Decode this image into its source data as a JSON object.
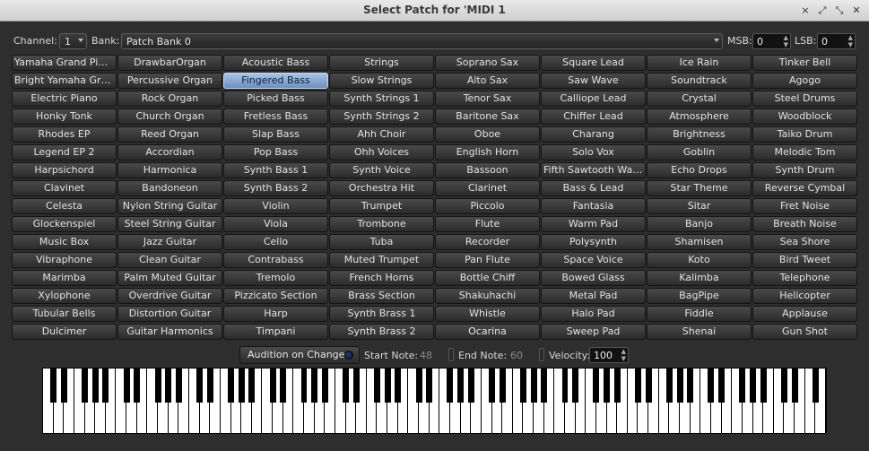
{
  "window": {
    "title": "Select Patch for 'MIDI 1",
    "buttons": [
      "×",
      "⤢",
      "⤡",
      "✕"
    ]
  },
  "toolbar": {
    "channel_label": "Channel:",
    "channel_value": "1",
    "bank_label": "Bank:",
    "bank_value": "Patch Bank 0",
    "msb_label": "MSB:",
    "msb_value": "0",
    "lsb_label": "LSB:",
    "lsb_value": "0"
  },
  "patches": [
    "Yamaha Grand Piano",
    "Bright Yamaha Grand",
    "Electric Piano",
    "Honky Tonk",
    "Rhodes EP",
    "Legend EP 2",
    "Harpsichord",
    "Clavinet",
    "Celesta",
    "Glockenspiel",
    "Music Box",
    "Vibraphone",
    "Marimba",
    "Xylophone",
    "Tubular Bells",
    "Dulcimer",
    "DrawbarOrgan",
    "Percussive Organ",
    "Rock Organ",
    "Church Organ",
    "Reed Organ",
    "Accordian",
    "Harmonica",
    "Bandoneon",
    "Nylon String Guitar",
    "Steel String Guitar",
    "Jazz Guitar",
    "Clean Guitar",
    "Palm Muted Guitar",
    "Overdrive Guitar",
    "Distortion Guitar",
    "Guitar Harmonics",
    "Acoustic Bass",
    "Fingered Bass",
    "Picked Bass",
    "Fretless Bass",
    "Slap Bass",
    "Pop Bass",
    "Synth Bass 1",
    "Synth Bass 2",
    "Violin",
    "Viola",
    "Cello",
    "Contrabass",
    "Tremolo",
    "Pizzicato Section",
    "Harp",
    "Timpani",
    "Strings",
    "Slow Strings",
    "Synth Strings 1",
    "Synth Strings 2",
    "Ahh Choir",
    "Ohh Voices",
    "Synth Voice",
    "Orchestra Hit",
    "Trumpet",
    "Trombone",
    "Tuba",
    "Muted Trumpet",
    "French Horns",
    "Brass Section",
    "Synth Brass 1",
    "Synth Brass 2",
    "Soprano Sax",
    "Alto Sax",
    "Tenor Sax",
    "Baritone Sax",
    "Oboe",
    "English Horn",
    "Bassoon",
    "Clarinet",
    "Piccolo",
    "Flute",
    "Recorder",
    "Pan Flute",
    "Bottle Chiff",
    "Shakuhachi",
    "Whistle",
    "Ocarina",
    "Square Lead",
    "Saw Wave",
    "Calliope Lead",
    "Chiffer Lead",
    "Charang",
    "Solo Vox",
    "Fifth Sawtooth Wave",
    "Bass & Lead",
    "Fantasia",
    "Warm Pad",
    "Polysynth",
    "Space Voice",
    "Bowed Glass",
    "Metal Pad",
    "Halo Pad",
    "Sweep Pad",
    "Ice Rain",
    "Soundtrack",
    "Crystal",
    "Atmosphere",
    "Brightness",
    "Goblin",
    "Echo Drops",
    "Star Theme",
    "Sitar",
    "Banjo",
    "Shamisen",
    "Koto",
    "Kalimba",
    "BagPipe",
    "Fiddle",
    "Shenai",
    "Tinker Bell",
    "Agogo",
    "Steel Drums",
    "Woodblock",
    "Taiko Drum",
    "Melodic Tom",
    "Synth Drum",
    "Reverse Cymbal",
    "Fret Noise",
    "Breath Noise",
    "Sea Shore",
    "Bird Tweet",
    "Telephone",
    "Helicopter",
    "Applause",
    "Gun Shot"
  ],
  "selected_patch": "Fingered Bass",
  "controls": {
    "audition_label": "Audition on Change",
    "start_note_label": "Start Note:",
    "start_note_value": "48",
    "end_note_label": "End Note:",
    "end_note_value": "60",
    "velocity_label": "Velocity:",
    "velocity_value": "100"
  },
  "keyboard": {
    "white_keys": 75
  }
}
